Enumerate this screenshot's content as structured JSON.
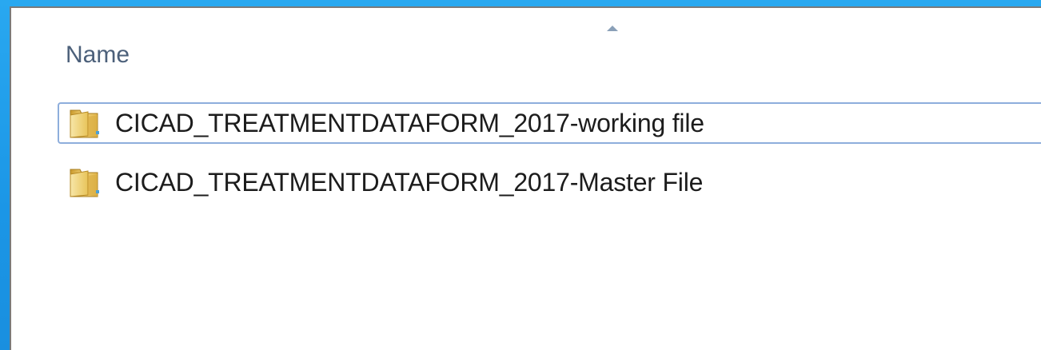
{
  "file_list": {
    "column_header": "Name",
    "sort_indicator": "ascending",
    "items": [
      {
        "label": "CICAD_TREATMENTDATAFORM_2017-working file",
        "icon": "folder-icon",
        "selected": true
      },
      {
        "label": "CICAD_TREATMENTDATAFORM_2017-Master File",
        "icon": "folder-icon",
        "selected": false
      }
    ]
  },
  "colors": {
    "background": "#1E9BEA",
    "header_text": "#4c607a",
    "selection_border": "#8eaedc"
  }
}
